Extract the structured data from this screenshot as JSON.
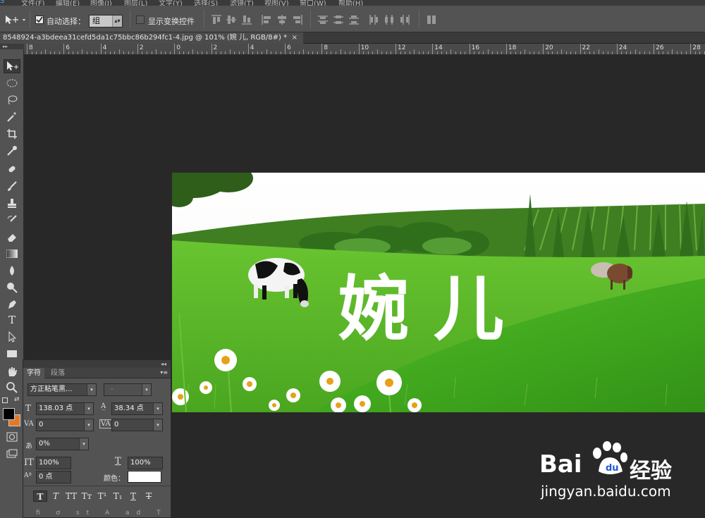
{
  "menu": [
    "文件(F)",
    "编辑(E)",
    "图像(I)",
    "图层(L)",
    "文字(Y)",
    "选择(S)",
    "滤镜(T)",
    "视图(V)",
    "窗口(W)",
    "帮助(H)"
  ],
  "options": {
    "move_tool_icon": "move-arrow-icon",
    "auto_select_label": "自动选择：",
    "auto_select_checked": true,
    "auto_select_value": "组",
    "show_transform_label": "显示变换控件",
    "show_transform_checked": false
  },
  "document": {
    "tab_title": "8548924-a3bdeea31cefd5da1c75bbc86b294fc1-4.jpg @ 101% (婉 儿, RGB/8#) *",
    "close": "×"
  },
  "ruler": {
    "labels": [
      "8",
      "6",
      "4",
      "2",
      "0",
      "2",
      "4",
      "6",
      "8",
      "10",
      "12",
      "14",
      "16",
      "18",
      "20",
      "22",
      "24",
      "26",
      "28"
    ]
  },
  "canvas_text": "婉 儿",
  "character_panel": {
    "tab_character": "字符",
    "tab_paragraph": "段落",
    "font_family": "方正粘笔黑...",
    "font_style": "-",
    "font_size": "138.03 点",
    "leading": "38.34 点",
    "kerning": "0",
    "tracking": "0",
    "vertical_scale_pct": "0%",
    "vertical_scale": "100%",
    "horizontal_scale": "100%",
    "baseline_shift": "0 点",
    "color_label": "颜色：",
    "text_color": "#ffffff",
    "style_buttons": [
      "T",
      "T",
      "TT",
      "Tт",
      "T¹",
      "T₁",
      "T",
      "T"
    ]
  },
  "colors": {
    "foreground": "#000000",
    "background": "#e07a2a"
  },
  "watermark": {
    "brand": "Bai",
    "brand2": "经验",
    "url": "jingyan.baidu.com"
  }
}
